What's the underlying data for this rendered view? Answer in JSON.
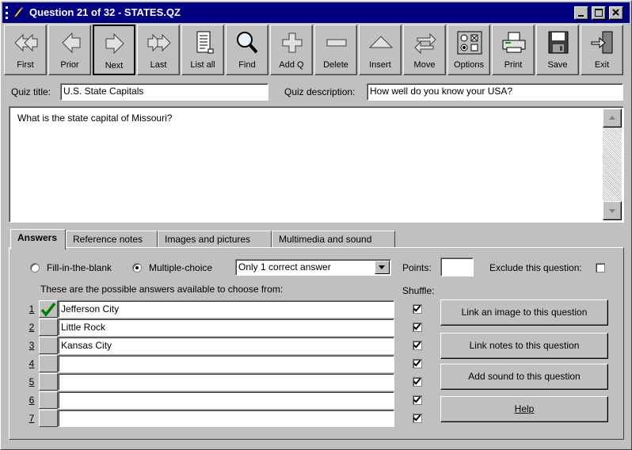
{
  "window": {
    "title": "Question 21 of 32 - STATES.QZ"
  },
  "toolbar": {
    "buttons": [
      {
        "label": "First",
        "icon": "first-arrow-icon"
      },
      {
        "label": "Prior",
        "icon": "left-arrow-icon"
      },
      {
        "label": "Next",
        "icon": "right-arrow-icon",
        "pressed": true
      },
      {
        "label": "Last",
        "icon": "last-arrow-icon"
      },
      {
        "label": "List all",
        "icon": "list-document-icon"
      },
      {
        "label": "Find",
        "icon": "magnifier-icon"
      },
      {
        "label": "Add Q",
        "icon": "plus-icon"
      },
      {
        "label": "Delete",
        "icon": "minus-icon"
      },
      {
        "label": "Insert",
        "icon": "triangle-icon"
      },
      {
        "label": "Move",
        "icon": "move-arrows-icon"
      },
      {
        "label": "Options",
        "icon": "options-icon"
      },
      {
        "label": "Print",
        "icon": "printer-icon"
      },
      {
        "label": "Save",
        "icon": "floppy-disk-icon"
      },
      {
        "label": "Exit",
        "icon": "exit-door-icon"
      }
    ]
  },
  "quiz": {
    "title_label": "Quiz title:",
    "title_value": "U.S. State Capitals",
    "description_label": "Quiz description:",
    "description_value": "How well do you know your USA?"
  },
  "question": {
    "text": "What is the state capital of Missouri?"
  },
  "tabs": [
    "Answers",
    "Reference notes",
    "Images and pictures",
    "Multimedia and sound"
  ],
  "answers_tab": {
    "fill_blank_label": "Fill-in-the-blank",
    "multiple_choice_label": "Multiple-choice",
    "selected_mode": "Multiple-choice",
    "correct_mode_value": "Only 1 correct answer",
    "points_label": "Points:",
    "points_value": "",
    "exclude_label": "Exclude this question:",
    "exclude_checked": false,
    "possible_answers_label": "These are the possible answers available to choose from:",
    "shuffle_label": "Shuffle:",
    "rows": [
      {
        "num": "1",
        "text": "Jefferson City",
        "correct": true,
        "shuffle": true
      },
      {
        "num": "2",
        "text": "Little Rock",
        "correct": false,
        "shuffle": true
      },
      {
        "num": "3",
        "text": "Kansas City",
        "correct": false,
        "shuffle": true
      },
      {
        "num": "4",
        "text": "",
        "correct": false,
        "shuffle": true
      },
      {
        "num": "5",
        "text": "",
        "correct": false,
        "shuffle": true
      },
      {
        "num": "6",
        "text": "",
        "correct": false,
        "shuffle": true
      },
      {
        "num": "7",
        "text": "",
        "correct": false,
        "shuffle": true
      }
    ],
    "buttons": {
      "link_image": "Link an image to this question",
      "link_notes": "Link notes to this question",
      "add_sound": "Add sound to this question",
      "help": "Help"
    }
  },
  "colors": {
    "titlebar": "#000080",
    "face": "#c0c0c0",
    "checkmark": "#008000"
  }
}
